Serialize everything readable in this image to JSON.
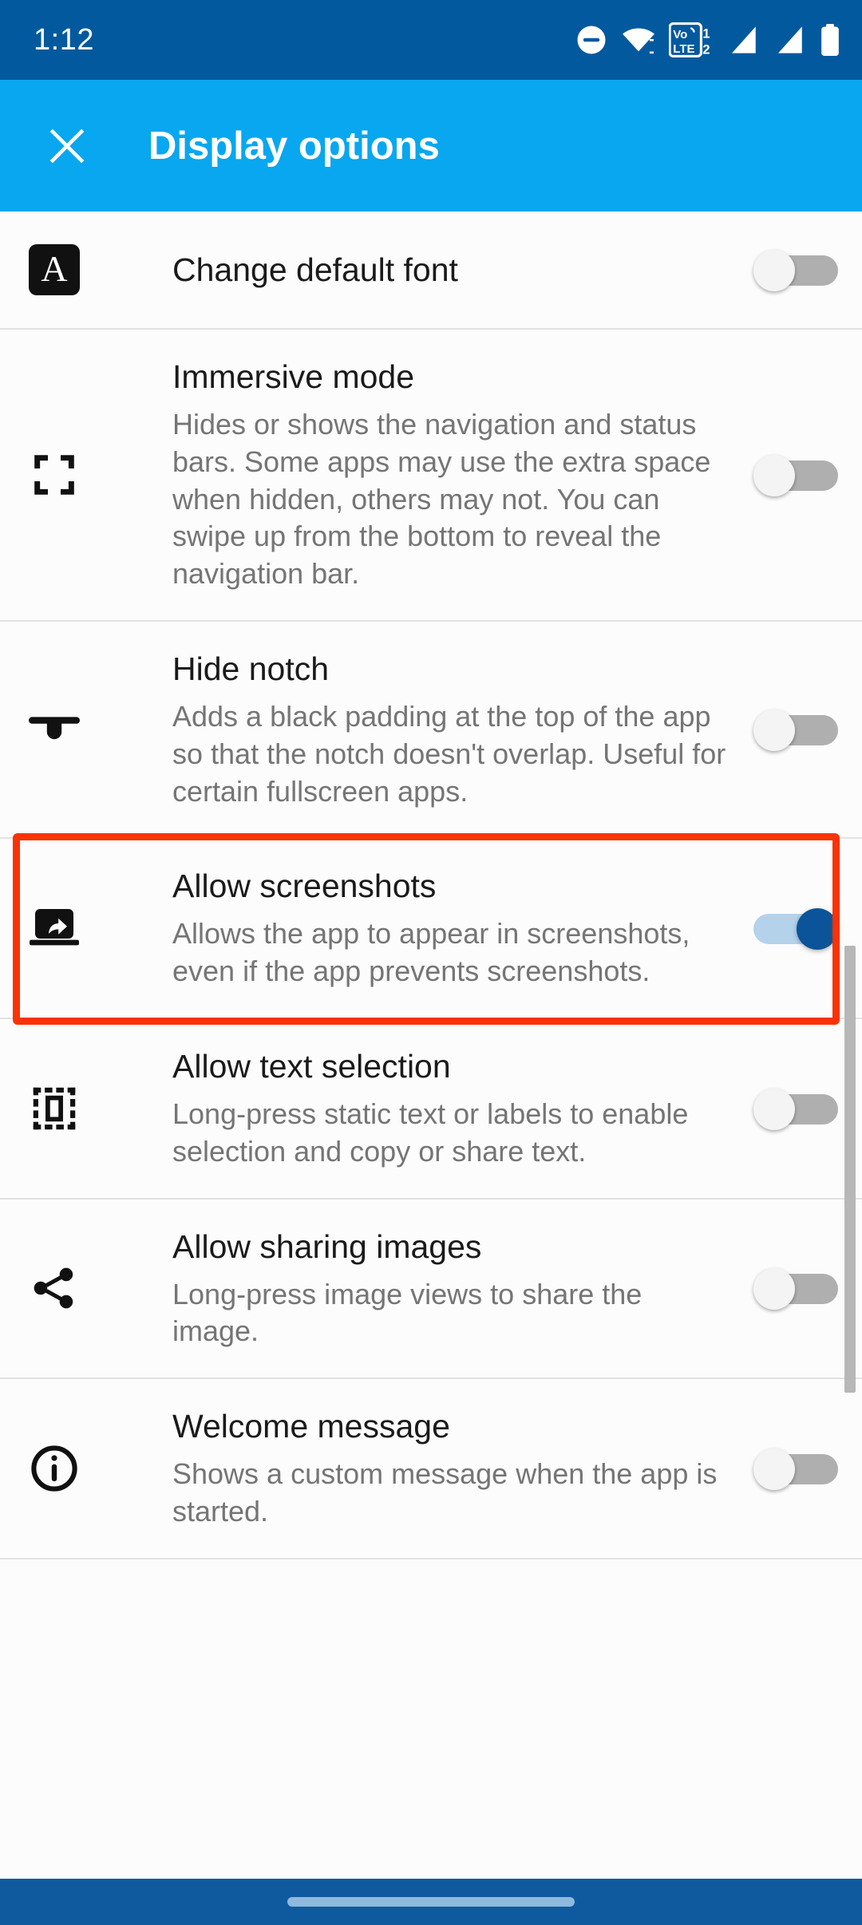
{
  "status_bar": {
    "time": "1:12",
    "icons": [
      {
        "name": "do-not-disturb-icon",
        "label": "Do not disturb"
      },
      {
        "name": "wifi-icon",
        "label": "Wi-Fi"
      },
      {
        "name": "volte-icon",
        "label": "VoLTE",
        "text_top": "Vo",
        "text_bottom": "LTE",
        "sim1": "1",
        "sim2": "2"
      },
      {
        "name": "signal-sim1-icon",
        "label": "Mobile signal SIM 1"
      },
      {
        "name": "signal-sim2-icon",
        "label": "Mobile signal SIM 2"
      },
      {
        "name": "battery-icon",
        "label": "Battery"
      }
    ],
    "background_color": "#03599E"
  },
  "app_bar": {
    "close_label": "Close",
    "title": "Display options",
    "background_color": "#09A7EF",
    "title_color": "#FFFFFF"
  },
  "settings": {
    "items": [
      {
        "id": "change-default-font",
        "icon": "font-a-icon",
        "title": "Change default font",
        "description": "",
        "toggle_on": false
      },
      {
        "id": "immersive-mode",
        "icon": "fullscreen-corners-icon",
        "title": "Immersive mode",
        "description": "Hides or shows the navigation and status bars. Some apps may use the extra space when hidden, others may not. You can swipe up from the bottom to reveal the navigation bar.",
        "toggle_on": false
      },
      {
        "id": "hide-notch",
        "icon": "notch-icon",
        "title": "Hide notch",
        "description": "Adds a black padding at the top of the app so that the notch doesn't overlap. Useful for certain fullscreen apps.",
        "toggle_on": false
      },
      {
        "id": "allow-screenshots",
        "icon": "screenshot-share-icon",
        "title": "Allow screenshots",
        "description": "Allows the app to appear in screenshots, even if the app prevents screenshots.",
        "toggle_on": true,
        "highlighted": true
      },
      {
        "id": "allow-text-selection",
        "icon": "text-selection-icon",
        "title": "Allow text selection",
        "description": "Long-press static text or labels to enable selection and copy or share text.",
        "toggle_on": false
      },
      {
        "id": "allow-sharing-images",
        "icon": "share-icon",
        "title": "Allow sharing images",
        "description": "Long-press image views to share the image.",
        "toggle_on": false
      },
      {
        "id": "welcome-message",
        "icon": "info-icon",
        "title": "Welcome message",
        "description": "Shows a custom message when the app is started.",
        "toggle_on": false
      }
    ]
  },
  "highlight": {
    "target": "allow-screenshots",
    "color": "#F93305"
  },
  "colors": {
    "toggle_on_track": "#B4D2EA",
    "toggle_on_thumb": "#0B5499",
    "toggle_off_track": "#AFAFAF",
    "toggle_off_thumb": "#F4F4F4",
    "list_background": "#FCFCFC",
    "divider": "#E2E2E2",
    "title_text": "#1A1A1A",
    "description_text": "#757575",
    "scrollbar": "#B7B7B7",
    "nav_bar": "#0F5A9E",
    "nav_pill": "#8FB9DC"
  },
  "nav_bar": {
    "gesture_handle": "home-gesture-pill"
  }
}
